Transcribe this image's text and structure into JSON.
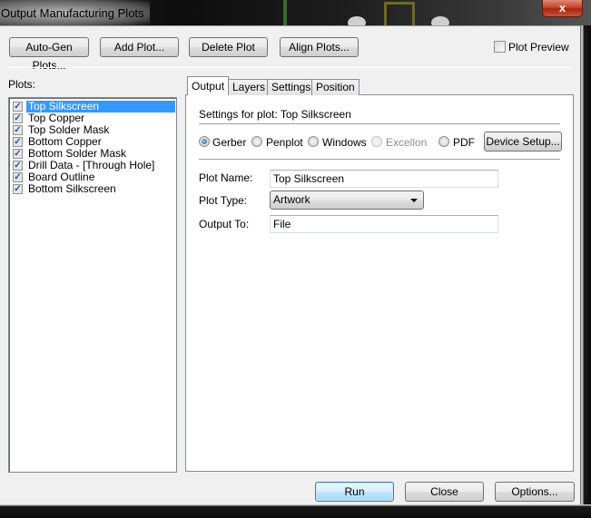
{
  "window": {
    "title": "Output Manufacturing Plots",
    "close_glyph": "x"
  },
  "toolbar": {
    "auto_gen_label": "Auto-Gen Plots...",
    "add_plot_label": "Add Plot...",
    "delete_plot_label": "Delete Plot",
    "align_plots_label": "Align Plots...",
    "plot_preview_label": "Plot Preview",
    "plot_preview_checked": false
  },
  "plots": {
    "label": "Plots:",
    "items": [
      {
        "label": "Top Silkscreen",
        "checked": true,
        "selected": true
      },
      {
        "label": "Top Copper",
        "checked": true,
        "selected": false
      },
      {
        "label": "Top Solder Mask",
        "checked": true,
        "selected": false
      },
      {
        "label": "Bottom Copper",
        "checked": true,
        "selected": false
      },
      {
        "label": "Bottom Solder Mask",
        "checked": true,
        "selected": false
      },
      {
        "label": "Drill Data - [Through Hole]",
        "checked": true,
        "selected": false
      },
      {
        "label": "Board Outline",
        "checked": true,
        "selected": false
      },
      {
        "label": "Bottom Silkscreen",
        "checked": true,
        "selected": false
      }
    ],
    "check_glyph": "✓"
  },
  "tabs": [
    {
      "label": "Output",
      "active": true
    },
    {
      "label": "Layers",
      "active": false
    },
    {
      "label": "Settings",
      "active": false
    },
    {
      "label": "Position",
      "active": false
    }
  ],
  "output": {
    "settings_heading": "Settings for plot: Top Silkscreen",
    "formats": [
      {
        "label": "Gerber",
        "checked": true,
        "disabled": false
      },
      {
        "label": "Penplot",
        "checked": false,
        "disabled": false
      },
      {
        "label": "Windows",
        "checked": false,
        "disabled": false
      },
      {
        "label": "Excellon",
        "checked": false,
        "disabled": true
      },
      {
        "label": "PDF",
        "checked": false,
        "disabled": false
      }
    ],
    "device_setup_label": "Device Setup...",
    "plot_name_label": "Plot Name:",
    "plot_name_value": "Top Silkscreen",
    "plot_type_label": "Plot Type:",
    "plot_type_value": "Artwork",
    "output_to_label": "Output To:",
    "output_to_value": "File"
  },
  "footer": {
    "run_label": "Run",
    "close_label": "Close",
    "options_label": "Options..."
  }
}
